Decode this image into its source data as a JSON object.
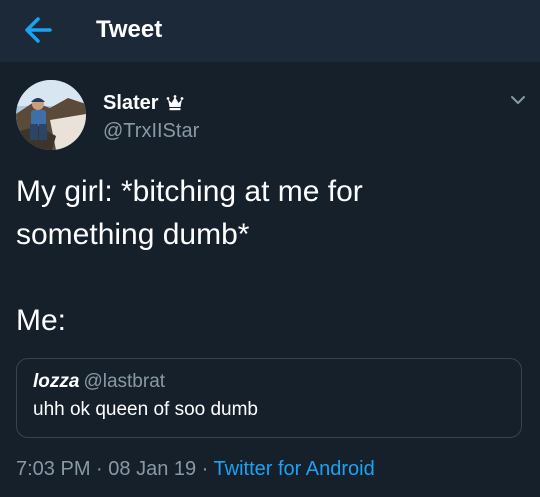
{
  "colors": {
    "background": "#15202b",
    "header_background": "#1c2938",
    "accent": "#1da1f2",
    "secondary_text": "#8899a6",
    "border": "#38444d"
  },
  "header": {
    "title": "Tweet",
    "back_icon": "arrow-left-icon"
  },
  "tweet": {
    "author": {
      "name": "Slater",
      "badge_icon": "crown-icon",
      "handle": "@TrxIIStar"
    },
    "text_lines": [
      "My girl: *bitching at me for",
      "something dumb*",
      "",
      "Me:"
    ],
    "quote": {
      "name": "lozza",
      "handle": "@lastbrat",
      "text": "uhh ok queen of soo dumb"
    },
    "meta": {
      "time": "7:03 PM",
      "sep1": " · ",
      "date": "08 Jan 19",
      "sep2": " · ",
      "source": "Twitter for Android"
    }
  }
}
